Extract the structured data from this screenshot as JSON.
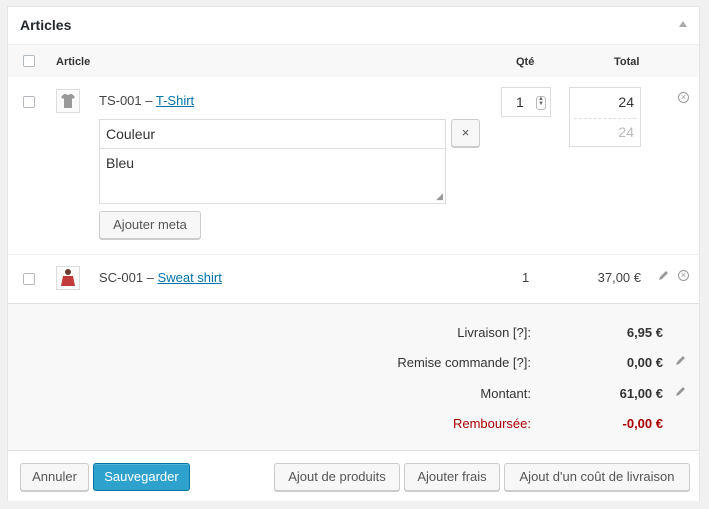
{
  "panel": {
    "title": "Articles"
  },
  "columns": {
    "article": "Article",
    "qty": "Qté",
    "total": "Total"
  },
  "items": [
    {
      "sku": "TS-001 – ",
      "name": "T-Shirt",
      "qty": "1",
      "total": "24",
      "total_tax": "24",
      "meta_key": "Couleur",
      "meta_value": "Bleu",
      "add_meta": "Ajouter meta",
      "remove_meta": "×"
    },
    {
      "sku": "SC-001 – ",
      "name": "Sweat shirt",
      "qty": "1",
      "total": "37,00 €"
    }
  ],
  "totals": [
    {
      "label": "Livraison [?]:",
      "value": "6,95 €"
    },
    {
      "label": "Remise commande [?]:",
      "value": "0,00 €"
    },
    {
      "label": "Montant:",
      "value": "61,00 €"
    },
    {
      "label": "Remboursée:",
      "value": "-0,00 €"
    }
  ],
  "buttons": {
    "cancel": "Annuler",
    "save": "Sauvegarder",
    "add_products": "Ajout de produits",
    "add_fees": "Ajouter frais",
    "add_shipping": "Ajout d'un coût de livraison"
  },
  "colors": {
    "accent": "#2ea2cc",
    "link": "#0073aa",
    "refund": "#aa0000"
  }
}
